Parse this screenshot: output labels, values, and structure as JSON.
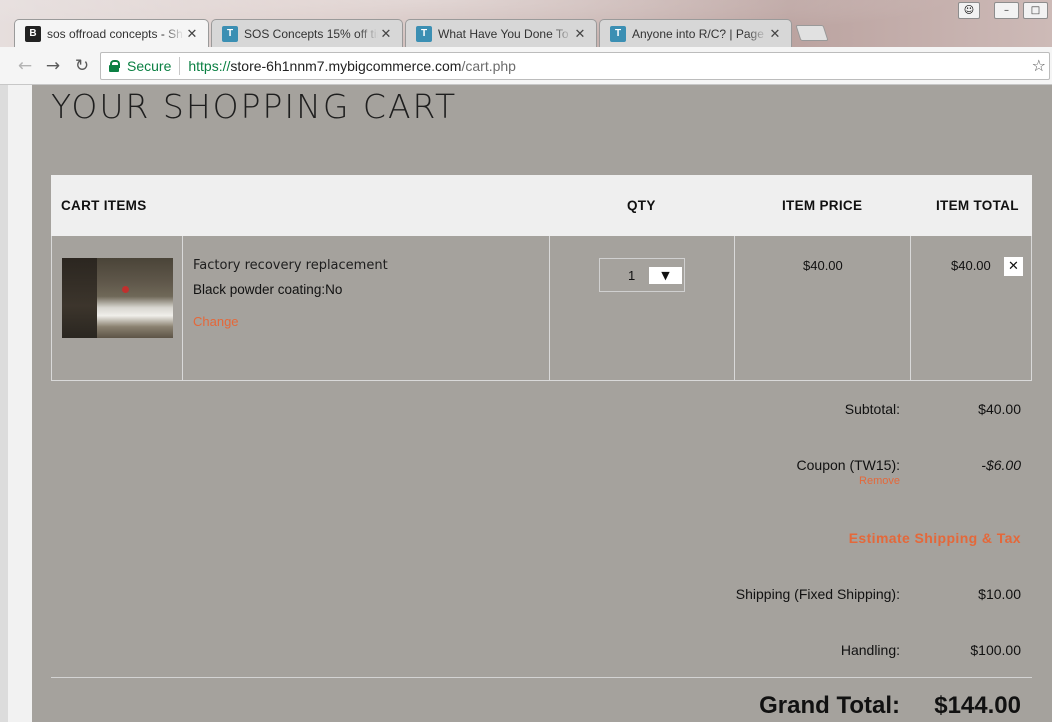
{
  "browser": {
    "tabs": [
      {
        "title": "sos offroad concepts - Sh",
        "favicon": "B",
        "active": true
      },
      {
        "title": "SOS Concepts 15% off tir",
        "favicon": "T",
        "active": false
      },
      {
        "title": "What Have You Done To",
        "favicon": "T",
        "active": false
      },
      {
        "title": "Anyone into R/C? | Page",
        "favicon": "T",
        "active": false
      }
    ],
    "security_label": "Secure",
    "url": {
      "scheme": "https://",
      "host": "store-6h1nnm7.mybigcommerce.com",
      "path": "/cart.php"
    }
  },
  "page": {
    "title": "YOUR SHOPPING CART",
    "columns": {
      "items": "CART ITEMS",
      "qty": "QTY",
      "price": "ITEM PRICE",
      "total": "ITEM TOTAL"
    },
    "item": {
      "name": "Factory recovery replacement",
      "option": "Black powder coating:No",
      "change_label": "Change",
      "qty": "1",
      "price": "$40.00",
      "total": "$40.00"
    },
    "summary": {
      "subtotal_label": "Subtotal:",
      "subtotal_value": "$40.00",
      "coupon_label": "Coupon (TW15):",
      "coupon_value": "-$6.00",
      "coupon_remove": "Remove",
      "estimate_label": "Estimate Shipping & Tax",
      "shipping_label": "Shipping (Fixed Shipping):",
      "shipping_value": "$10.00",
      "handling_label": "Handling:",
      "handling_value": "$100.00",
      "grand_label": "Grand Total:",
      "grand_value": "$144.00"
    }
  },
  "colors": {
    "accent": "#e4683a",
    "page_bg": "#a5a29d",
    "secure": "#0b8043"
  }
}
